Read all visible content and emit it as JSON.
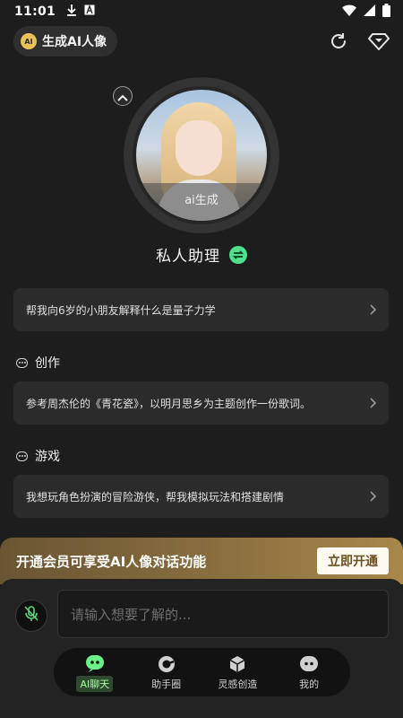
{
  "status_bar": {
    "time": "11:01"
  },
  "header": {
    "chip_badge": "AI",
    "chip_label": "生成AI人像"
  },
  "avatar": {
    "tag": "ai生成"
  },
  "assistant": {
    "name": "私人助理"
  },
  "prompts": [
    {
      "text": "帮我向6岁的小朋友解释什么是量子力学"
    },
    {
      "section": "创作",
      "text": "参考周杰伦的《青花瓷》，以明月思乡为主题创作一份歌词。"
    },
    {
      "section": "游戏",
      "text": "我想玩角色扮演的冒险游侠，帮我模拟玩法和搭建剧情"
    }
  ],
  "vip": {
    "text": "开通会员可享受AI人像对话功能",
    "button": "立即开通"
  },
  "input": {
    "placeholder": "请输入想要了解的..."
  },
  "nav": [
    {
      "label": "AI聊天",
      "icon": "chat-robot-icon"
    },
    {
      "label": "助手圈",
      "icon": "circle-icon"
    },
    {
      "label": "灵感创造",
      "icon": "cube-icon"
    },
    {
      "label": "我的",
      "icon": "profile-icon"
    }
  ],
  "colors": {
    "accent": "#6cf088",
    "gold": "#8a6f3f",
    "background": "#1d1d1d"
  }
}
